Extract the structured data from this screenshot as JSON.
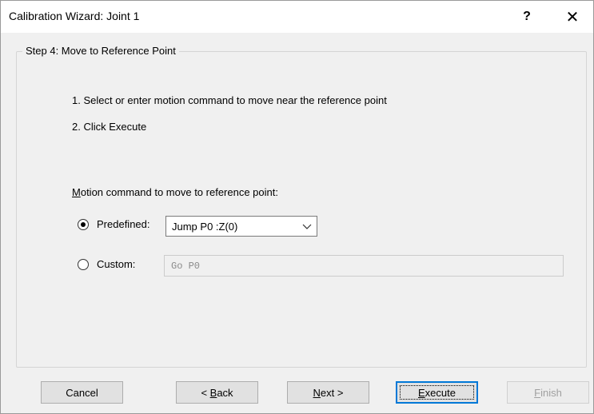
{
  "window": {
    "title": "Calibration Wizard: Joint 1",
    "help_glyph": "?",
    "close_glyph": "✕"
  },
  "step": {
    "title": "Step 4: Move to Reference Point",
    "instruction_1": "1. Select or enter motion command to move near the reference point",
    "instruction_2": "2. Click Execute"
  },
  "motion": {
    "label_prefix": "M",
    "label_rest": "otion command to move to reference point:",
    "predefined_label": "Predefined:",
    "predefined_selected": true,
    "predefined_value": "Jump P0 :Z(0)",
    "custom_label": "Custom:",
    "custom_selected": false,
    "custom_value": "Go P0"
  },
  "buttons": {
    "cancel": "Cancel",
    "back_prefix": "< ",
    "back_key": "B",
    "back_rest": "ack",
    "next_key": "N",
    "next_rest": "ext >",
    "execute_key": "E",
    "execute_rest": "xecute",
    "finish_key": "F",
    "finish_rest": "inish",
    "finish_enabled": false
  },
  "colors": {
    "focus_border": "#0078d7",
    "disabled_text": "#a0a0a0",
    "dialog_bg": "#f0f0f0"
  }
}
